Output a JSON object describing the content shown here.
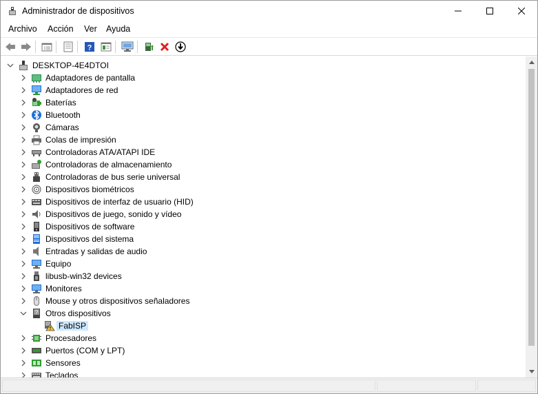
{
  "window": {
    "title": "Administrador de dispositivos"
  },
  "menu": {
    "items": [
      "Archivo",
      "Acción",
      "Ver",
      "Ayuda"
    ]
  },
  "toolbar": {
    "buttons": [
      "back-icon",
      "forward-icon",
      "properties-window-icon",
      "driver-details-icon",
      "help-icon",
      "view-icon",
      "monitor-scan-icon",
      "update-driver-icon",
      "uninstall-icon",
      "download-icon"
    ]
  },
  "tree": {
    "root": "DESKTOP-4E4DTOI",
    "categories": [
      {
        "label": "Adaptadores de pantalla",
        "icon": "display-adapter-icon",
        "expanded": false
      },
      {
        "label": "Adaptadores de red",
        "icon": "network-adapter-icon",
        "expanded": false
      },
      {
        "label": "Baterías",
        "icon": "battery-icon",
        "expanded": false
      },
      {
        "label": "Bluetooth",
        "icon": "bluetooth-icon",
        "expanded": false
      },
      {
        "label": "Cámaras",
        "icon": "camera-icon",
        "expanded": false
      },
      {
        "label": "Colas de impresión",
        "icon": "printer-icon",
        "expanded": false
      },
      {
        "label": "Controladoras ATA/ATAPI IDE",
        "icon": "ide-controller-icon",
        "expanded": false
      },
      {
        "label": "Controladoras de almacenamiento",
        "icon": "storage-controller-icon",
        "expanded": false
      },
      {
        "label": "Controladoras de bus serie universal",
        "icon": "usb-icon",
        "expanded": false
      },
      {
        "label": "Dispositivos biométricos",
        "icon": "fingerprint-icon",
        "expanded": false
      },
      {
        "label": "Dispositivos de interfaz de usuario (HID)",
        "icon": "hid-icon",
        "expanded": false
      },
      {
        "label": "Dispositivos de juego, sonido y vídeo",
        "icon": "speaker-icon",
        "expanded": false
      },
      {
        "label": "Dispositivos de software",
        "icon": "software-device-icon",
        "expanded": false
      },
      {
        "label": "Dispositivos del sistema",
        "icon": "system-device-icon",
        "expanded": false
      },
      {
        "label": "Entradas y salidas de audio",
        "icon": "audio-io-icon",
        "expanded": false
      },
      {
        "label": "Equipo",
        "icon": "computer-icon",
        "expanded": false
      },
      {
        "label": "libusb-win32 devices",
        "icon": "usb-device-icon",
        "expanded": false
      },
      {
        "label": "Monitores",
        "icon": "monitor-icon",
        "expanded": false
      },
      {
        "label": "Mouse y otros dispositivos señaladores",
        "icon": "mouse-icon",
        "expanded": false
      },
      {
        "label": "Otros dispositivos",
        "icon": "unknown-device-icon",
        "expanded": true,
        "children": [
          {
            "label": "FabISP",
            "icon": "warning-device-icon"
          }
        ]
      },
      {
        "label": "Procesadores",
        "icon": "processor-icon",
        "expanded": false
      },
      {
        "label": "Puertos (COM y LPT)",
        "icon": "port-icon",
        "expanded": false
      },
      {
        "label": "Sensores",
        "icon": "sensor-icon",
        "expanded": false
      },
      {
        "label": "Teclados",
        "icon": "keyboard-icon",
        "expanded": false
      }
    ]
  },
  "colors": {
    "selection": "#cce8ff",
    "chevron": "#606060",
    "accent": "#1e6fd9"
  }
}
